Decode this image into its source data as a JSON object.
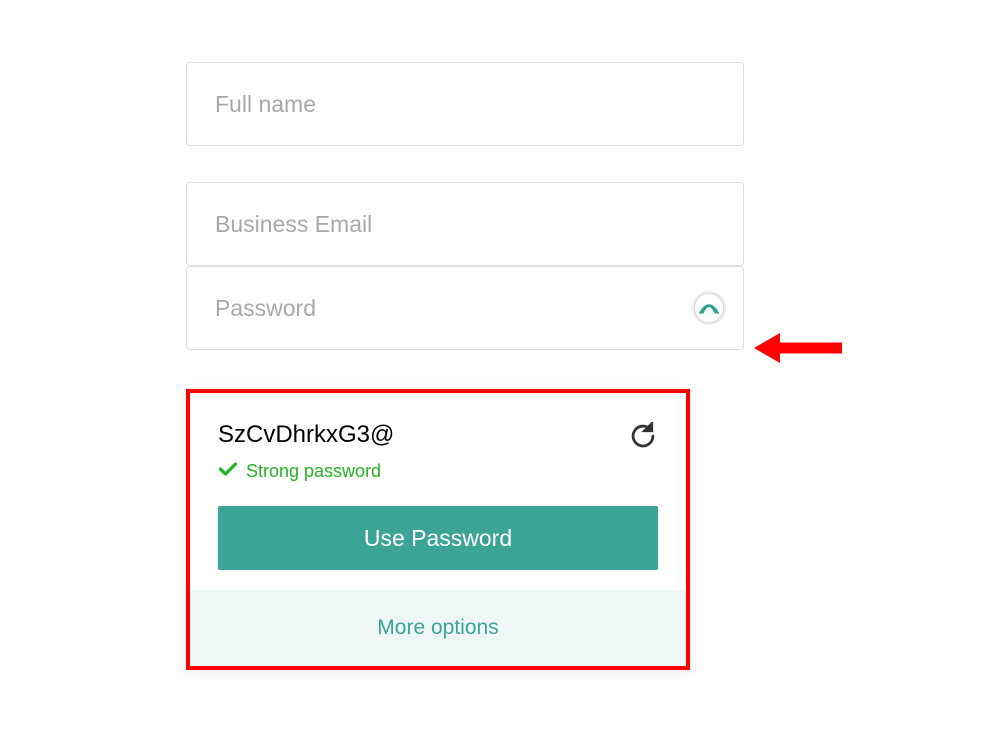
{
  "form": {
    "fullname_placeholder": "Full name",
    "email_placeholder": "Business Email",
    "password_placeholder": "Password"
  },
  "popup": {
    "generated_password": "SzCvDhrkxG3@",
    "strength_label": "Strong password",
    "use_button_label": "Use Password",
    "more_options_label": "More options"
  },
  "colors": {
    "accent": "#3ba497",
    "success": "#23b423",
    "annotation": "#fd0101"
  }
}
